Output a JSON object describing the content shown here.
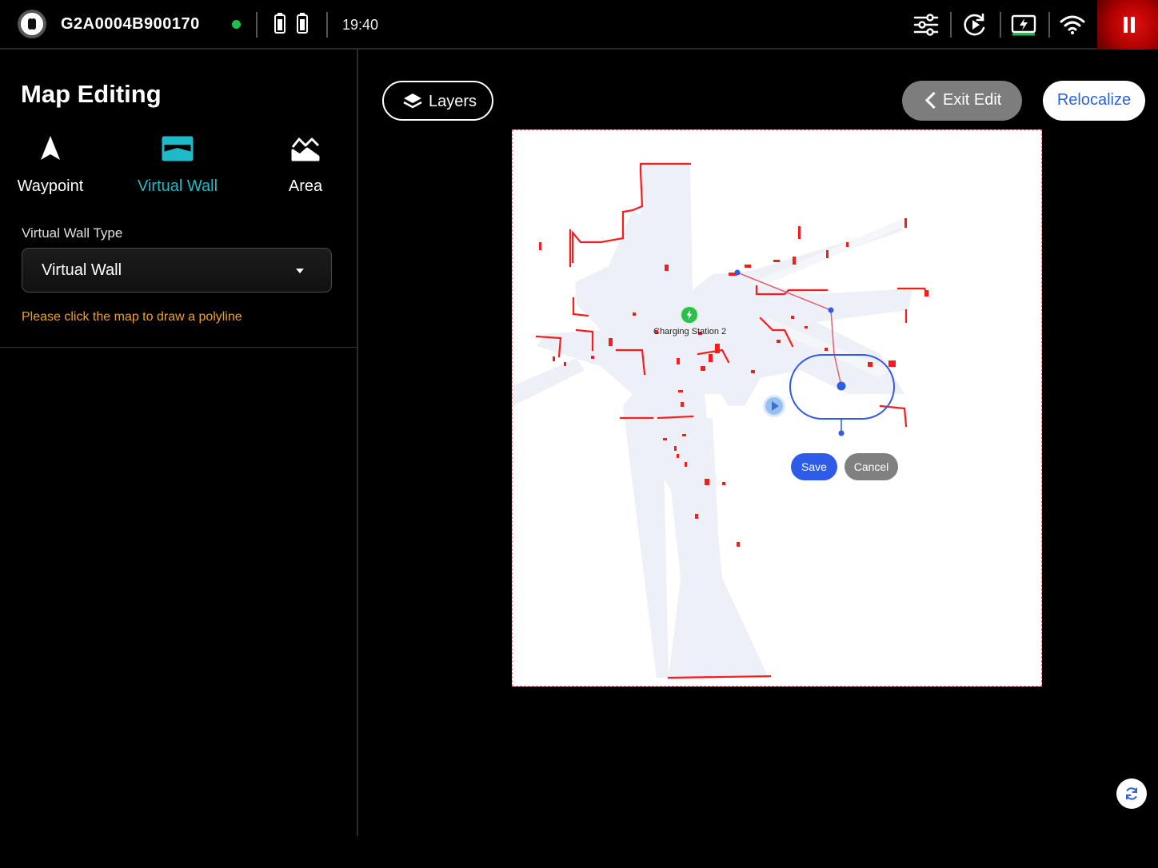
{
  "status_bar": {
    "device_id": "G2A0004B900170",
    "connection_status_color": "#1fbf4a",
    "time": "19:40",
    "icons": [
      "robot-face-icon",
      "battery-icon",
      "battery-icon",
      "settings-sliders-icon",
      "sync-play-icon",
      "screen-charge-icon",
      "wifi-icon",
      "pause-icon"
    ]
  },
  "panel": {
    "title": "Map Editing",
    "tools": [
      {
        "label": "Waypoint",
        "icon": "navigation-arrow-icon",
        "active": false
      },
      {
        "label": "Virtual Wall",
        "icon": "virtual-wall-icon",
        "active": true
      },
      {
        "label": "Area",
        "icon": "area-mountain-icon",
        "active": false
      }
    ],
    "virtual_wall_type_label": "Virtual Wall Type",
    "virtual_wall_type_value": "Virtual Wall",
    "hint": "Please click the map to draw a polyline"
  },
  "toolbar": {
    "layers_label": "Layers",
    "exit_edit_label": "Exit Edit",
    "relocalize_label": "Relocalize"
  },
  "map": {
    "charging_station_label": "Charging Station 2",
    "save_label": "Save",
    "cancel_label": "Cancel",
    "accent_color": "#2e5be8",
    "obstacle_color": "#ff1a1a"
  },
  "colors": {
    "active_tab": "#1fb9c9",
    "hint": "#f0a020",
    "relocalize_text": "#2e63d8"
  }
}
